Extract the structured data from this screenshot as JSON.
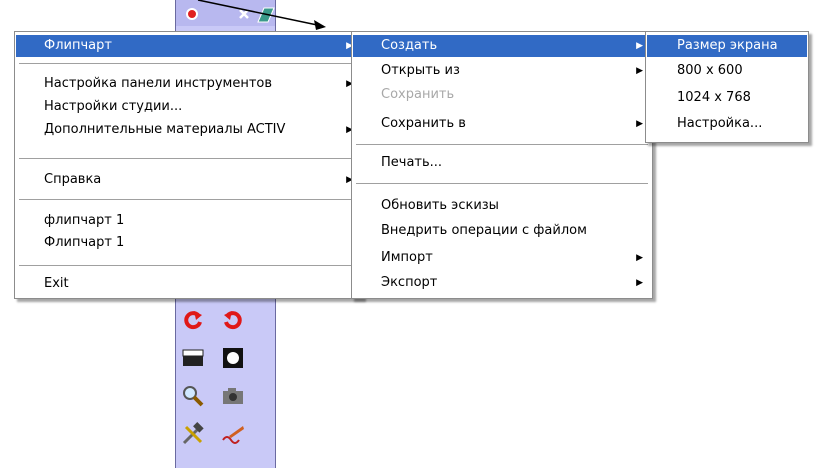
{
  "main_menu": {
    "items": [
      {
        "label": "Флипчарт"
      },
      {
        "label": "Настройка панели инструментов"
      },
      {
        "label": "Настройки студии..."
      },
      {
        "label": "Дополнительные материалы ACTIV"
      },
      {
        "label": "Справка"
      },
      {
        "label": "флипчарт 1"
      },
      {
        "label": "Флипчарт 1"
      },
      {
        "label": "Exit"
      }
    ]
  },
  "flipchart_menu": {
    "items": [
      {
        "label": "Создать"
      },
      {
        "label": "Открыть из"
      },
      {
        "label": "Сохранить"
      },
      {
        "label": "Сохранить в"
      },
      {
        "label": "Печать..."
      },
      {
        "label": "Обновить эскизы"
      },
      {
        "label": "Внедрить операции с файлом"
      },
      {
        "label": "Импорт"
      },
      {
        "label": "Экспорт"
      }
    ]
  },
  "create_menu": {
    "items": [
      {
        "label": "Размер экрана"
      },
      {
        "label": "800 x 600"
      },
      {
        "label": "1024 x 768"
      },
      {
        "label": "Настройка..."
      }
    ]
  },
  "colors": {
    "highlight": "#316ac5",
    "toolbar": "#c9c9f7"
  },
  "icons": [
    "undo-icon",
    "redo-icon",
    "blind-icon",
    "spotlight-icon",
    "magnifier-icon",
    "camera-icon",
    "tools-icon",
    "handwriting-icon",
    "close-icon"
  ]
}
